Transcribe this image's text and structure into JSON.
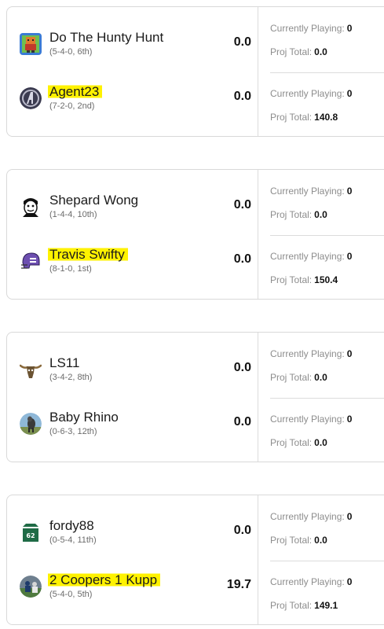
{
  "labels": {
    "currently_playing": "Currently Playing:",
    "proj_total": "Proj Total:"
  },
  "matchups": [
    {
      "teams": [
        {
          "name": "Do The Hunty Hunt",
          "record": "(5-4-0, 6th)",
          "score": "0.0",
          "currently_playing": "0",
          "proj_total": "0.0",
          "avatar_icon": "pixel-character-icon",
          "highlighted": false
        },
        {
          "name": "Agent23",
          "record": "(7-2-0, 2nd)",
          "score": "0.0",
          "currently_playing": "0",
          "proj_total": "140.8",
          "avatar_icon": "avengers-logo-icon",
          "highlighted": true
        }
      ]
    },
    {
      "teams": [
        {
          "name": "Shepard Wong",
          "record": "(1-4-4, 10th)",
          "score": "0.0",
          "currently_playing": "0",
          "proj_total": "0.0",
          "avatar_icon": "cartoon-face-icon",
          "highlighted": false
        },
        {
          "name": "Travis Swifty",
          "record": "(8-1-0, 1st)",
          "score": "0.0",
          "currently_playing": "0",
          "proj_total": "150.4",
          "avatar_icon": "purple-helmet-icon",
          "highlighted": true
        }
      ]
    },
    {
      "teams": [
        {
          "name": "LS11",
          "record": "(3-4-2, 8th)",
          "score": "0.0",
          "currently_playing": "0",
          "proj_total": "0.0",
          "avatar_icon": "longhorn-skull-icon",
          "highlighted": false
        },
        {
          "name": "Baby Rhino",
          "record": "(0-6-3, 12th)",
          "score": "0.0",
          "currently_playing": "0",
          "proj_total": "0.0",
          "avatar_icon": "goat-photo-icon",
          "highlighted": false
        }
      ]
    },
    {
      "teams": [
        {
          "name": "fordy88",
          "record": "(0-5-4, 11th)",
          "score": "0.0",
          "currently_playing": "0",
          "proj_total": "0.0",
          "avatar_icon": "green-jersey-icon",
          "highlighted": false
        },
        {
          "name": "2 Coopers 1 Kupp",
          "record": "(5-4-0, 5th)",
          "score": "19.7",
          "currently_playing": "0",
          "proj_total": "149.1",
          "avatar_icon": "football-photo-icon",
          "highlighted": true
        }
      ]
    }
  ]
}
